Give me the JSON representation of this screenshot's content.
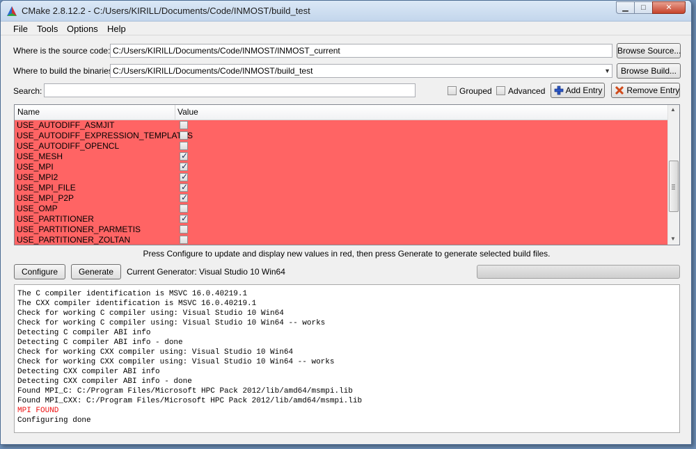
{
  "window": {
    "title": "CMake 2.8.12.2 - C:/Users/KIRILL/Documents/Code/INMOST/build_test",
    "minimize_glyph": "▁",
    "maximize_glyph": "□",
    "close_glyph": "✕"
  },
  "menu": {
    "file": "File",
    "tools": "Tools",
    "options": "Options",
    "help": "Help"
  },
  "source": {
    "label": "Where is the source code:",
    "value": "C:/Users/KIRILL/Documents/Code/INMOST/INMOST_current",
    "browse": "Browse Source..."
  },
  "binaries": {
    "label": "Where to build the binaries:",
    "value": "C:/Users/KIRILL/Documents/Code/INMOST/build_test",
    "browse": "Browse Build..."
  },
  "search": {
    "label": "Search:",
    "value": "",
    "grouped": "Grouped",
    "grouped_checked": false,
    "advanced": "Advanced",
    "advanced_checked": false,
    "add_entry": "Add Entry",
    "remove_entry": "Remove Entry"
  },
  "table": {
    "col_name": "Name",
    "col_value": "Value",
    "highlight_color": "#ff6464",
    "rows": [
      {
        "name": "USE_AUTODIFF_ASMJIT",
        "checked": false
      },
      {
        "name": "USE_AUTODIFF_EXPRESSION_TEMPLATES",
        "checked": false
      },
      {
        "name": "USE_AUTODIFF_OPENCL",
        "checked": false
      },
      {
        "name": "USE_MESH",
        "checked": true
      },
      {
        "name": "USE_MPI",
        "checked": true
      },
      {
        "name": "USE_MPI2",
        "checked": true
      },
      {
        "name": "USE_MPI_FILE",
        "checked": true
      },
      {
        "name": "USE_MPI_P2P",
        "checked": true
      },
      {
        "name": "USE_OMP",
        "checked": false
      },
      {
        "name": "USE_PARTITIONER",
        "checked": true
      },
      {
        "name": "USE_PARTITIONER_PARMETIS",
        "checked": false
      },
      {
        "name": "USE_PARTITIONER_ZOLTAN",
        "checked": false
      }
    ]
  },
  "hint": "Press Configure to update and display new values in red, then press Generate to generate selected build files.",
  "actions": {
    "configure": "Configure",
    "generate": "Generate",
    "generator": "Current Generator: Visual Studio 10 Win64",
    "progress": 0
  },
  "log": [
    {
      "text": "The C compiler identification is MSVC 16.0.40219.1",
      "error": false
    },
    {
      "text": "The CXX compiler identification is MSVC 16.0.40219.1",
      "error": false
    },
    {
      "text": "Check for working C compiler using: Visual Studio 10 Win64",
      "error": false
    },
    {
      "text": "Check for working C compiler using: Visual Studio 10 Win64 -- works",
      "error": false
    },
    {
      "text": "Detecting C compiler ABI info",
      "error": false
    },
    {
      "text": "Detecting C compiler ABI info - done",
      "error": false
    },
    {
      "text": "Check for working CXX compiler using: Visual Studio 10 Win64",
      "error": false
    },
    {
      "text": "Check for working CXX compiler using: Visual Studio 10 Win64 -- works",
      "error": false
    },
    {
      "text": "Detecting CXX compiler ABI info",
      "error": false
    },
    {
      "text": "Detecting CXX compiler ABI info - done",
      "error": false
    },
    {
      "text": "Found MPI_C: C:/Program Files/Microsoft HPC Pack 2012/lib/amd64/msmpi.lib",
      "error": false
    },
    {
      "text": "Found MPI_CXX: C:/Program Files/Microsoft HPC Pack 2012/lib/amd64/msmpi.lib",
      "error": false
    },
    {
      "text": "MPI FOUND",
      "error": true
    },
    {
      "text": "Configuring done",
      "error": false
    }
  ]
}
